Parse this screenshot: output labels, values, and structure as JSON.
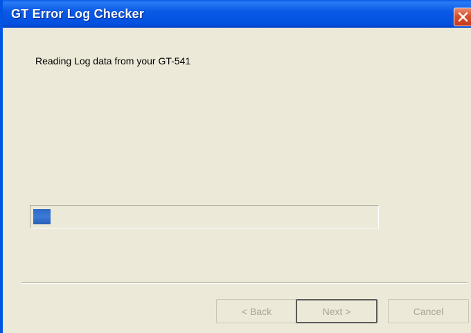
{
  "window": {
    "title": "GT Error Log Checker"
  },
  "main": {
    "message": "Reading Log data from your GT-541",
    "progress": 0.05
  },
  "buttons": {
    "back": "< Back",
    "next": "Next >",
    "cancel": "Cancel"
  },
  "colors": {
    "titlebar": "#0450e0",
    "dialog_bg": "#ece9d8",
    "progress_fill": "#2f69c6",
    "close": "#d8502e",
    "disabled_text": "#a7a497"
  },
  "icons": {
    "close": "close-icon"
  }
}
